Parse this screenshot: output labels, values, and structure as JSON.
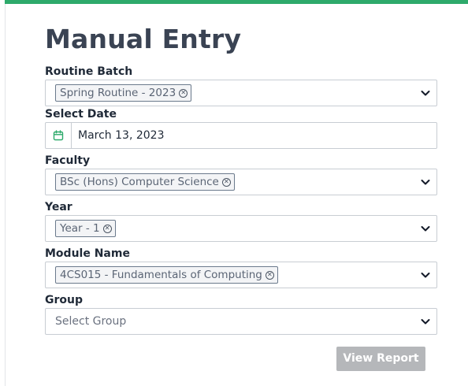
{
  "title": "Manual Entry",
  "routine_batch": {
    "label": "Routine Batch",
    "selected": "Spring Routine - 2023"
  },
  "select_date": {
    "label": "Select Date",
    "value": "March 13, 2023"
  },
  "faculty": {
    "label": "Faculty",
    "selected": "BSc (Hons) Computer Science"
  },
  "year": {
    "label": "Year",
    "selected": "Year - 1"
  },
  "module": {
    "label": "Module Name",
    "selected": "4CS015 - Fundamentals of Computing"
  },
  "group": {
    "label": "Group",
    "placeholder": "Select Group"
  },
  "actions": {
    "view_report": "View Report"
  },
  "colors": {
    "accent": "#2eaa6b",
    "disabled_button": "#b5b7ba"
  }
}
